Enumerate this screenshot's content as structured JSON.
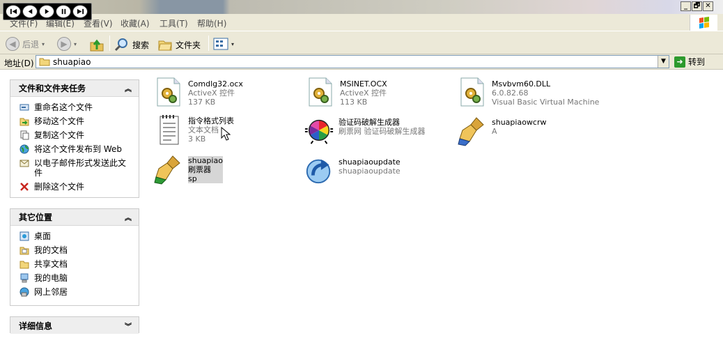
{
  "menu": [
    "文件(F)",
    "编辑(E)",
    "查看(V)",
    "收藏(A)",
    "工具(T)",
    "帮助(H)"
  ],
  "window_buttons": [
    "_",
    "🗗",
    "✕"
  ],
  "toolbar": {
    "back": "后退",
    "search": "搜索",
    "folders": "文件夹"
  },
  "address": {
    "label": "地址(D)",
    "path": "shuapiao",
    "go": "转到"
  },
  "panels": {
    "tasks": {
      "title": "文件和文件夹任务",
      "items": [
        "重命名这个文件",
        "移动这个文件",
        "复制这个文件",
        "将这个文件发布到 Web",
        "以电子邮件形式发送此文件",
        "删除这个文件"
      ]
    },
    "places": {
      "title": "其它位置",
      "items": [
        "桌面",
        "我的文档",
        "共享文档",
        "我的电脑",
        "网上邻居"
      ]
    },
    "details": {
      "title": "详细信息"
    }
  },
  "files": [
    {
      "name": "Comdlg32.ocx",
      "line2": "ActiveX 控件",
      "line3": "137 KB",
      "icon": "activex-gear-icon"
    },
    {
      "name": "MSINET.OCX",
      "line2": "ActiveX 控件",
      "line3": "113 KB",
      "icon": "activex-gear-icon"
    },
    {
      "name": "Msvbvm60.DLL",
      "line2": "6.0.82.68",
      "line3": "Visual Basic Virtual Machine",
      "icon": "activex-gear-icon"
    },
    {
      "name": "指令格式列表",
      "line2": "文本文档",
      "line3": "3 KB",
      "icon": "notepad-icon"
    },
    {
      "name": "验证码破解生成器",
      "line2": "刷票网 验证码破解生成器",
      "line3": "",
      "icon": "color-wheel-icon"
    },
    {
      "name": "shuapiaowcrw",
      "line2": "A",
      "line3": "",
      "icon": "brush-icon"
    },
    {
      "name": "shuapiao",
      "line2": "刷票器",
      "line3": "sp",
      "icon": "brush-icon"
    },
    {
      "name": "shuapiaoupdate",
      "line2": "shuapiaoupdate",
      "line3": "",
      "icon": "update-arrow-icon"
    }
  ],
  "colors": {
    "panel_header": "#eeeeee",
    "chrome": "#ece9d8",
    "selection": "#d6d6d6"
  }
}
